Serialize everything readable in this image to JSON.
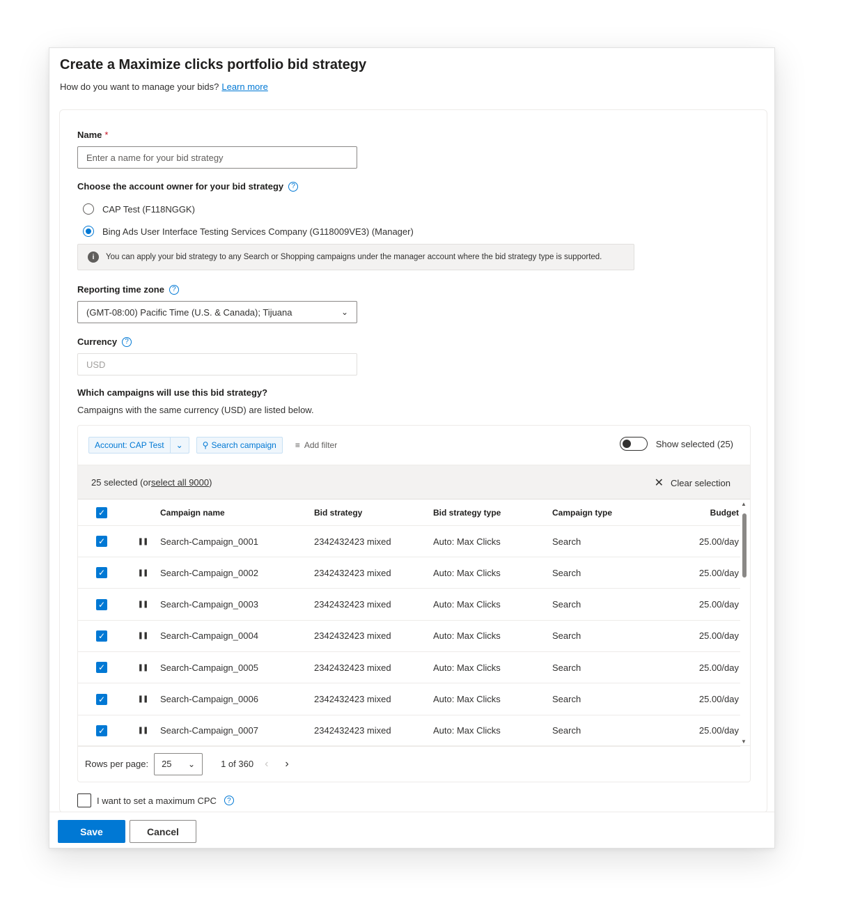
{
  "dialog": {
    "title": "Create a Maximize clicks portfolio bid strategy",
    "subtitle": "How do you want to manage your bids?",
    "learn_more": "Learn more"
  },
  "form": {
    "name_label": "Name",
    "name_required": "*",
    "name_placeholder": "Enter a name for your bid strategy",
    "owner_label": "Choose the account owner for your bid strategy",
    "owner_options": [
      {
        "label": "CAP Test (F118NGGK)",
        "selected": false
      },
      {
        "label": "Bing Ads User Interface Testing Services Company (G118009VE3) (Manager)",
        "selected": true
      }
    ],
    "owner_info": "You can apply your bid strategy to any Search or Shopping campaigns under the manager account where the bid strategy type is supported.",
    "timezone_label": "Reporting time zone",
    "timezone_value": "(GMT-08:00) Pacific Time (U.S. & Canada); Tijuana",
    "currency_label": "Currency",
    "currency_value": "USD",
    "campaigns_question": "Which campaigns will use this bid strategy?",
    "campaigns_note": "Campaigns with the same currency (USD) are listed below."
  },
  "grid": {
    "account_filter": "Account: CAP Test",
    "search_placeholder": "Search campaign",
    "add_filter": "Add filter",
    "show_selected": "Show selected (25)",
    "selection_prefix": "25 selected (or ",
    "select_all": "select all 9000",
    "selection_suffix": ")",
    "clear_selection": "Clear selection",
    "columns": [
      "Campaign name",
      "Bid strategy",
      "Bid strategy type",
      "Campaign type",
      "Budget"
    ],
    "rows": [
      {
        "name": "Search-Campaign_0001",
        "bid": "2342432423 mixed",
        "type": "Auto: Max Clicks",
        "ctype": "Search",
        "budget": "25.00/day"
      },
      {
        "name": "Search-Campaign_0002",
        "bid": "2342432423 mixed",
        "type": "Auto: Max Clicks",
        "ctype": "Search",
        "budget": "25.00/day"
      },
      {
        "name": "Search-Campaign_0003",
        "bid": "2342432423 mixed",
        "type": "Auto: Max Clicks",
        "ctype": "Search",
        "budget": "25.00/day"
      },
      {
        "name": "Search-Campaign_0004",
        "bid": "2342432423 mixed",
        "type": "Auto: Max Clicks",
        "ctype": "Search",
        "budget": "25.00/day"
      },
      {
        "name": "Search-Campaign_0005",
        "bid": "2342432423 mixed",
        "type": "Auto: Max Clicks",
        "ctype": "Search",
        "budget": "25.00/day"
      },
      {
        "name": "Search-Campaign_0006",
        "bid": "2342432423 mixed",
        "type": "Auto: Max Clicks",
        "ctype": "Search",
        "budget": "25.00/day"
      },
      {
        "name": "Search-Campaign_0007",
        "bid": "2342432423 mixed",
        "type": "Auto: Max Clicks",
        "ctype": "Search",
        "budget": "25.00/day"
      }
    ],
    "rows_per_page_label": "Rows per page:",
    "rows_per_page": "25",
    "page_info": "1 of 360"
  },
  "cpc_label": "I want to set a maximum CPC",
  "footer": {
    "save": "Save",
    "cancel": "Cancel"
  },
  "colors": {
    "accent": "#0078d4",
    "required": "#c50f1f"
  }
}
